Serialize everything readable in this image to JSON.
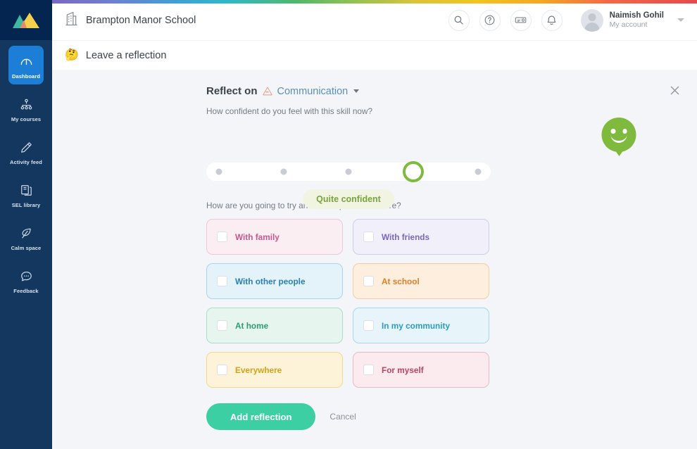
{
  "brand": {
    "logo_icon": "mountains-logo-icon",
    "school_icon": "building-icon",
    "school_name": "Brampton Manor School"
  },
  "sidebar": {
    "items": [
      {
        "label": "Dashboard",
        "icon": "dashboard-gauge-icon",
        "active": true
      },
      {
        "label": "My courses",
        "icon": "org-tree-icon",
        "active": false
      },
      {
        "label": "Activity feed",
        "icon": "pencil-icon",
        "active": false
      },
      {
        "label": "SEL library",
        "icon": "books-icon",
        "active": false
      },
      {
        "label": "Calm space",
        "icon": "leaf-icon",
        "active": false
      },
      {
        "label": "Feedback",
        "icon": "speech-bubble-icon",
        "active": false
      }
    ]
  },
  "topbar": {
    "icons": [
      {
        "name": "search-icon"
      },
      {
        "name": "help-question-icon"
      },
      {
        "name": "ticket-icon"
      },
      {
        "name": "notification-bell-icon"
      }
    ],
    "account": {
      "name": "Naimish Gohil",
      "subtitle": "My account",
      "avatar_icon": "avatar-icon",
      "caret_icon": "chevron-down-icon"
    }
  },
  "subbar": {
    "emoji": "🤔",
    "title": "Leave a reflection"
  },
  "panel": {
    "close_icon": "close-icon",
    "reflect_on_label": "Reflect on",
    "skill_icon": "mountain-skill-icon",
    "skill_name": "Communication",
    "skill_caret_icon": "chevron-down-icon",
    "question_1": "How confident do you feel with this skill now?",
    "question_2": "How are you going to try and develop this skill more?",
    "confidence": {
      "steps": 5,
      "selected_index": 4,
      "value_label": "Quite confident",
      "face_icon": "smiley-face-icon",
      "pill_bg": "#f2f4e2",
      "pill_text_color": "#7ba23c",
      "accent_color": "#7fba3f"
    },
    "options": [
      {
        "label": "With family",
        "bg": "#fbeef3",
        "border": "#ecc8d9",
        "text": "#c4588c",
        "checked": false
      },
      {
        "label": "With friends",
        "bg": "#f1f0fa",
        "border": "#cfcbe8",
        "text": "#7b66c0",
        "checked": false
      },
      {
        "label": "With other people",
        "bg": "#e4f2fa",
        "border": "#a8d4ea",
        "text": "#2a7fb0",
        "checked": false
      },
      {
        "label": "At school",
        "bg": "#fdeedd",
        "border": "#f2cda2",
        "text": "#d8802a",
        "checked": false
      },
      {
        "label": "At home",
        "bg": "#e6f6ef",
        "border": "#a8ddc6",
        "text": "#2e9c71",
        "checked": false
      },
      {
        "label": "In my community",
        "bg": "#e7f5fa",
        "border": "#a4d8e8",
        "text": "#2b9bbd",
        "checked": false
      },
      {
        "label": "Everywhere",
        "bg": "#fdf3d8",
        "border": "#f2d98a",
        "text": "#d4a11c",
        "checked": false
      },
      {
        "label": "For myself",
        "bg": "#fbebef",
        "border": "#e7b9c6",
        "text": "#bd4363",
        "checked": false
      }
    ],
    "submit_label": "Add reflection",
    "cancel_label": "Cancel"
  }
}
